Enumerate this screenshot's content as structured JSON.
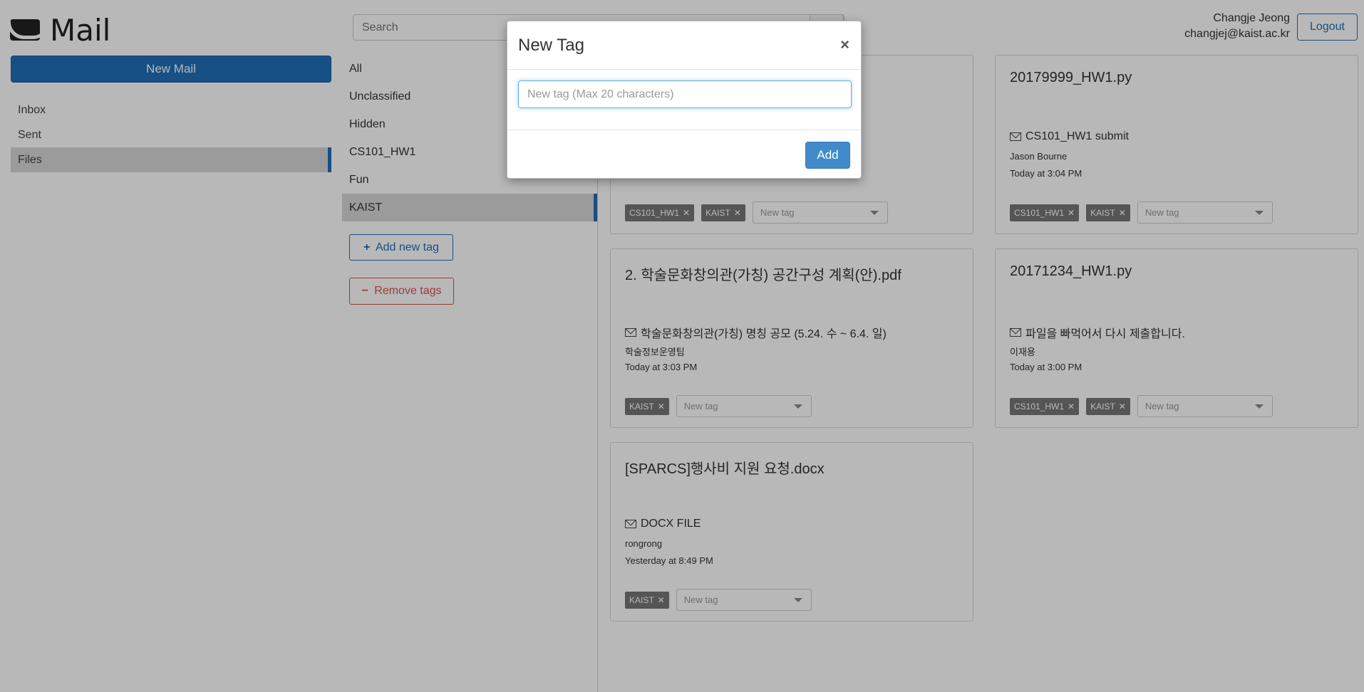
{
  "app": {
    "title": "Mail"
  },
  "sidebar": {
    "new_mail_label": "New Mail",
    "items": [
      {
        "label": "Inbox"
      },
      {
        "label": "Sent"
      },
      {
        "label": "Files"
      }
    ],
    "active": "Files"
  },
  "search": {
    "placeholder": "Search"
  },
  "tags": {
    "items": [
      {
        "label": "All"
      },
      {
        "label": "Unclassified"
      },
      {
        "label": "Hidden"
      },
      {
        "label": "CS101_HW1"
      },
      {
        "label": "Fun"
      },
      {
        "label": "KAIST"
      }
    ],
    "active": "KAIST",
    "add_label": "Add new tag",
    "add_glyph": "+",
    "remove_label": "Remove tags",
    "remove_glyph": "−"
  },
  "user": {
    "name": "Changje Jeong",
    "email": "changjej@kaist.ac.kr",
    "logout_label": "Logout"
  },
  "files": [
    {
      "title": "",
      "subject": "",
      "sender": "",
      "time": "",
      "tags": [
        "CS101_HW1",
        "KAIST"
      ],
      "new_tag_placeholder": "New tag"
    },
    {
      "title": "20179999_HW1.py",
      "subject": "CS101_HW1 submit",
      "sender": "Jason Bourne",
      "time": "Today at 3:04 PM",
      "tags": [
        "CS101_HW1",
        "KAIST"
      ],
      "new_tag_placeholder": "New tag"
    },
    {
      "title": "2. 학술문화창의관(가칭) 공간구성 계획(안).pdf",
      "subject": "학술문화창의관(가칭) 명칭 공모 (5.24. 수 ~ 6.4. 일)",
      "sender": "학술정보운영팀",
      "time": "Today at 3:03 PM",
      "tags": [
        "KAIST"
      ],
      "new_tag_placeholder": "New tag"
    },
    {
      "title": "20171234_HW1.py",
      "subject": "파일을 빠먹어서 다시 제출합니다.",
      "sender": "이재용",
      "time": "Today at 3:00 PM",
      "tags": [
        "CS101_HW1",
        "KAIST"
      ],
      "new_tag_placeholder": "New tag"
    },
    {
      "title": "[SPARCS]행사비 지원 요청.docx",
      "subject": "DOCX FILE",
      "sender": "rongrong",
      "time": "Yesterday at 8:49 PM",
      "tags": [
        "KAIST"
      ],
      "new_tag_placeholder": "New tag"
    }
  ],
  "modal": {
    "title": "New Tag",
    "close_glyph": "×",
    "input_placeholder": "New tag (Max 20 characters)",
    "input_value": "",
    "add_label": "Add"
  },
  "chip_remove_glyph": "✕"
}
